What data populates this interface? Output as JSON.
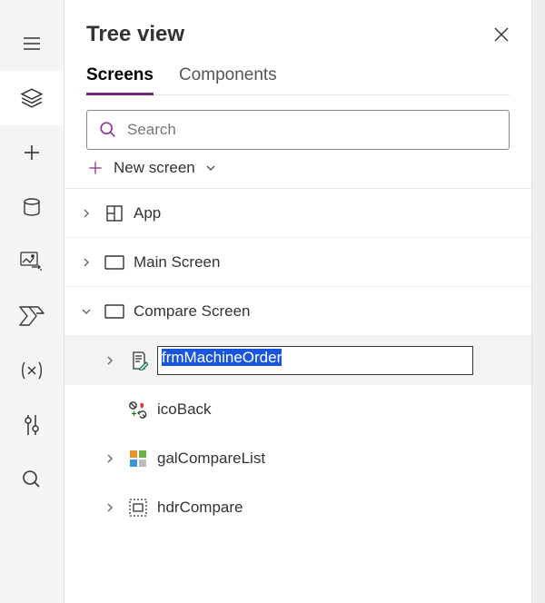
{
  "panel": {
    "title": "Tree view",
    "tabs": {
      "screens": "Screens",
      "components": "Components"
    },
    "search": {
      "placeholder": "Search"
    },
    "newScreen": "New screen"
  },
  "tree": {
    "app": "App",
    "main": "Main Screen",
    "compare": "Compare Screen",
    "frmRename": "frmMachineOrder",
    "icoBack": "icoBack",
    "gal": "galCompareList",
    "hdr": "hdrCompare"
  }
}
